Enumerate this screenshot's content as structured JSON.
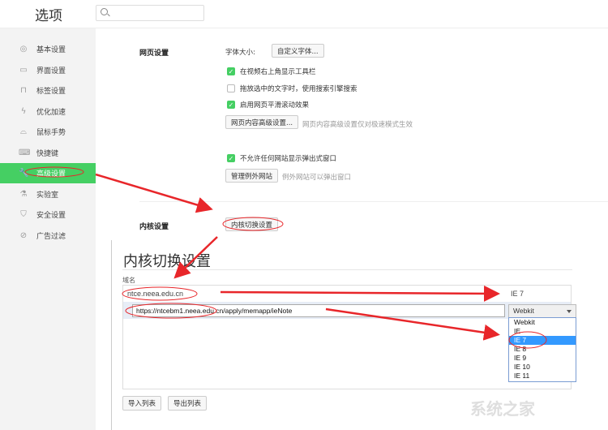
{
  "header": {
    "title": "选项",
    "search_placeholder": ""
  },
  "sidebar": {
    "items": [
      {
        "label": "基本设置",
        "icon": "circle-settings-icon",
        "glyph": "◎"
      },
      {
        "label": "界面设置",
        "icon": "window-icon",
        "glyph": "▭"
      },
      {
        "label": "标签设置",
        "icon": "tab-icon",
        "glyph": "⊓"
      },
      {
        "label": "优化加速",
        "icon": "lightning-icon",
        "glyph": "ϟ"
      },
      {
        "label": "鼠标手势",
        "icon": "mouse-icon",
        "glyph": "⌓"
      },
      {
        "label": "快捷键",
        "icon": "keyboard-icon",
        "glyph": "⌨"
      },
      {
        "label": "高级设置",
        "icon": "wrench-icon",
        "glyph": "🔧"
      },
      {
        "label": "实验室",
        "icon": "flask-icon",
        "glyph": "⚗"
      },
      {
        "label": "安全设置",
        "icon": "shield-icon",
        "glyph": "⛉"
      },
      {
        "label": "广告过滤",
        "icon": "block-icon",
        "glyph": "⊘"
      }
    ],
    "active_index": 6
  },
  "web": {
    "section": "网页设置",
    "font_size_label": "字体大小:",
    "custom_font_btn": "自定义字体...",
    "options": [
      {
        "label": "在视频右上角显示工具栏",
        "checked": true
      },
      {
        "label": "拖放选中的文字时，使用搜索引擎搜索",
        "checked": false
      },
      {
        "label": "启用网页平滑滚动效果",
        "checked": true
      }
    ],
    "advanced_btn": "网页内容高级设置...",
    "advanced_hint": "网页内容高级设置仅对极速模式生效",
    "popup_option": {
      "label": "不允许任何网站显示弹出式窗口",
      "checked": true
    },
    "exceptions_btn": "管理例外网站",
    "exceptions_hint": "例外网站可以弹出窗口"
  },
  "kernel": {
    "section": "内核设置",
    "switch_btn": "内核切换设置"
  },
  "dialog": {
    "title": "内核切换设置",
    "column_label": "域名",
    "rows": [
      {
        "domain": "ntce.neea.edu.cn",
        "kernel": "IE 7"
      }
    ],
    "edit_url": "https://ntcebm1.neea.edu.cn/apply/memapp/ieNote",
    "edit_kernel": "Webkit",
    "options": [
      "Webkit",
      "IE",
      "IE 7",
      "IE 8",
      "IE 9",
      "IE 10",
      "IE 11"
    ],
    "selected_option": "IE 7",
    "import_btn": "导入列表",
    "export_btn": "导出列表"
  },
  "watermark": "系统之家",
  "colors": {
    "accent": "#45cf63",
    "annotation": "#e8262a",
    "highlight": "#3399ff"
  }
}
